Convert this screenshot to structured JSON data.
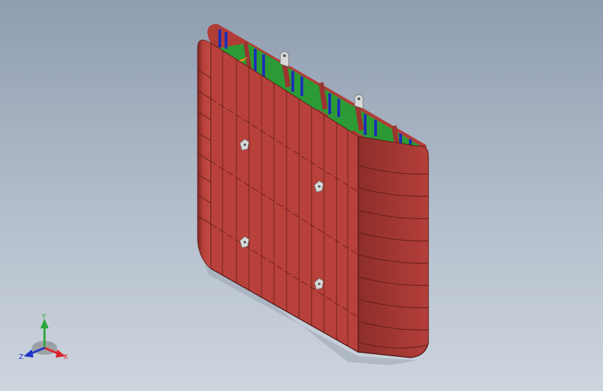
{
  "viewport": {
    "background_top": "#8f9db0",
    "background_bottom": "#cdd5de"
  },
  "model": {
    "shell_color": "#b9413b",
    "shell_dark": "#8f2f2b",
    "seam_color": "#5a1a18",
    "web_color": "#2c9a35",
    "stiffener_color": "#1d2fb8",
    "bracket_color": "#e08a1c",
    "lug_color": "#d9d9d9"
  },
  "triad": {
    "x_label": "X",
    "y_label": "Y",
    "z_label": "Z",
    "x_color": "#d8262a",
    "y_color": "#2aa63a",
    "z_color": "#2335c8",
    "icon": "coordinate-triad-icon"
  }
}
